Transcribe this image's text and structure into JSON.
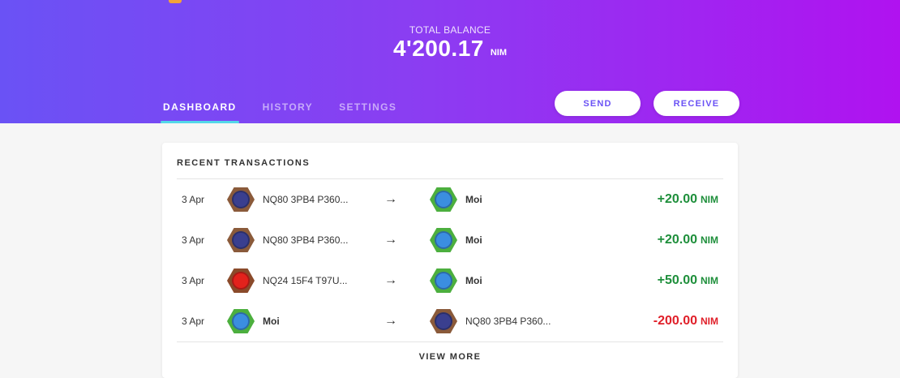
{
  "header": {
    "balance_label": "TOTAL BALANCE",
    "balance_amount": "4'200.17",
    "balance_unit": "NIM",
    "tabs": [
      {
        "label": "DASHBOARD",
        "active": true
      },
      {
        "label": "HISTORY",
        "active": false
      },
      {
        "label": "SETTINGS",
        "active": false
      }
    ],
    "send_label": "SEND",
    "receive_label": "RECEIVE"
  },
  "transactions": {
    "title": "RECENT TRANSACTIONS",
    "view_more_label": "VIEW MORE",
    "rows": [
      {
        "date": "3 Apr",
        "from": "NQ80 3PB4 P360...",
        "to": "Moi",
        "amount": "+20.00",
        "unit": "NIM"
      },
      {
        "date": "3 Apr",
        "from": "NQ80 3PB4 P360...",
        "to": "Moi",
        "amount": "+20.00",
        "unit": "NIM"
      },
      {
        "date": "3 Apr",
        "from": "NQ24 15F4 T97U...",
        "to": "Moi",
        "amount": "+50.00",
        "unit": "NIM"
      },
      {
        "date": "3 Apr",
        "from": "Moi",
        "to": "NQ80 3PB4 P360...",
        "amount": "-200.00",
        "unit": "NIM"
      }
    ]
  },
  "colors": {
    "gradient_start": "#6a52f5",
    "gradient_end": "#b012f0",
    "tab_indicator": "#53d8e9",
    "positive": "#1e8f3b",
    "negative": "#e0202a"
  },
  "icons": {
    "arrow": "right-arrow-icon",
    "identicon_nq80": "identicon-brown",
    "identicon_nq24": "identicon-red",
    "identicon_moi": "identicon-green"
  }
}
